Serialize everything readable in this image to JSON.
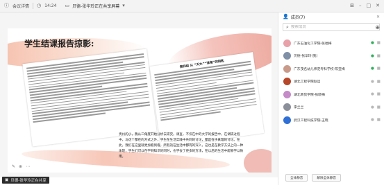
{
  "topbar": {
    "app_label": "会议详情",
    "time": "14:24",
    "title": "贝德-张华玲正在共享屏幕"
  },
  "slide": {
    "title": "学生结课报告掠影:",
    "paper_right_head": "第四组 从 “天大”“淮南”的钥匙",
    "summary": "贵州的小，我从二角度开始分析去研究。调查，不仅在中的大学的报告中，在调研过程中，与这个都在的方式之外，学生在生活实践中共同的讨论，都是在于真理的讨论。在此，我们在这里就更加看到看，所有的在生活中都有的深入，这也是在教学方法上的一种体现，学生们可以在学到知识的同时，也学会了更多的方法，在以后的生活中能够学以致用。"
  },
  "status_tab": {
    "label": "贝德-张华玲正在共享"
  },
  "panel": {
    "title": "成员(7)",
    "search_placeholder": "搜索成员",
    "members": [
      {
        "name": "广东石油化工学院-张福梅",
        "avatar_color": "#e8a1a8",
        "mic": "on"
      },
      {
        "name": "贝德-张华玲(我)",
        "avatar_color": "#7e8fa6",
        "mic": "on"
      },
      {
        "name": "广东茂名幼儿师范专科学校-陈亚梅",
        "avatar_color": "#c99a8a",
        "mic": "on"
      },
      {
        "name": "湖北工程学院赵远",
        "avatar_color": "#b7472a",
        "mic": "off"
      },
      {
        "name": "湖北商贸学院-张晓梅",
        "avatar_color": "#c48bc8",
        "mic": "off"
      },
      {
        "name": "李兰兰",
        "avatar_color": "#8a8f9a",
        "mic": "off"
      },
      {
        "name": "武汉工程科技学院-王晓",
        "avatar_color": "#2f6fd6",
        "mic": "off"
      }
    ],
    "buttons": {
      "mute_all": "全体静音",
      "unmute_all": "解除全体静音"
    }
  },
  "colors": {
    "accent_green": "#2fae5a",
    "brush_orange": "#f4b39c"
  }
}
